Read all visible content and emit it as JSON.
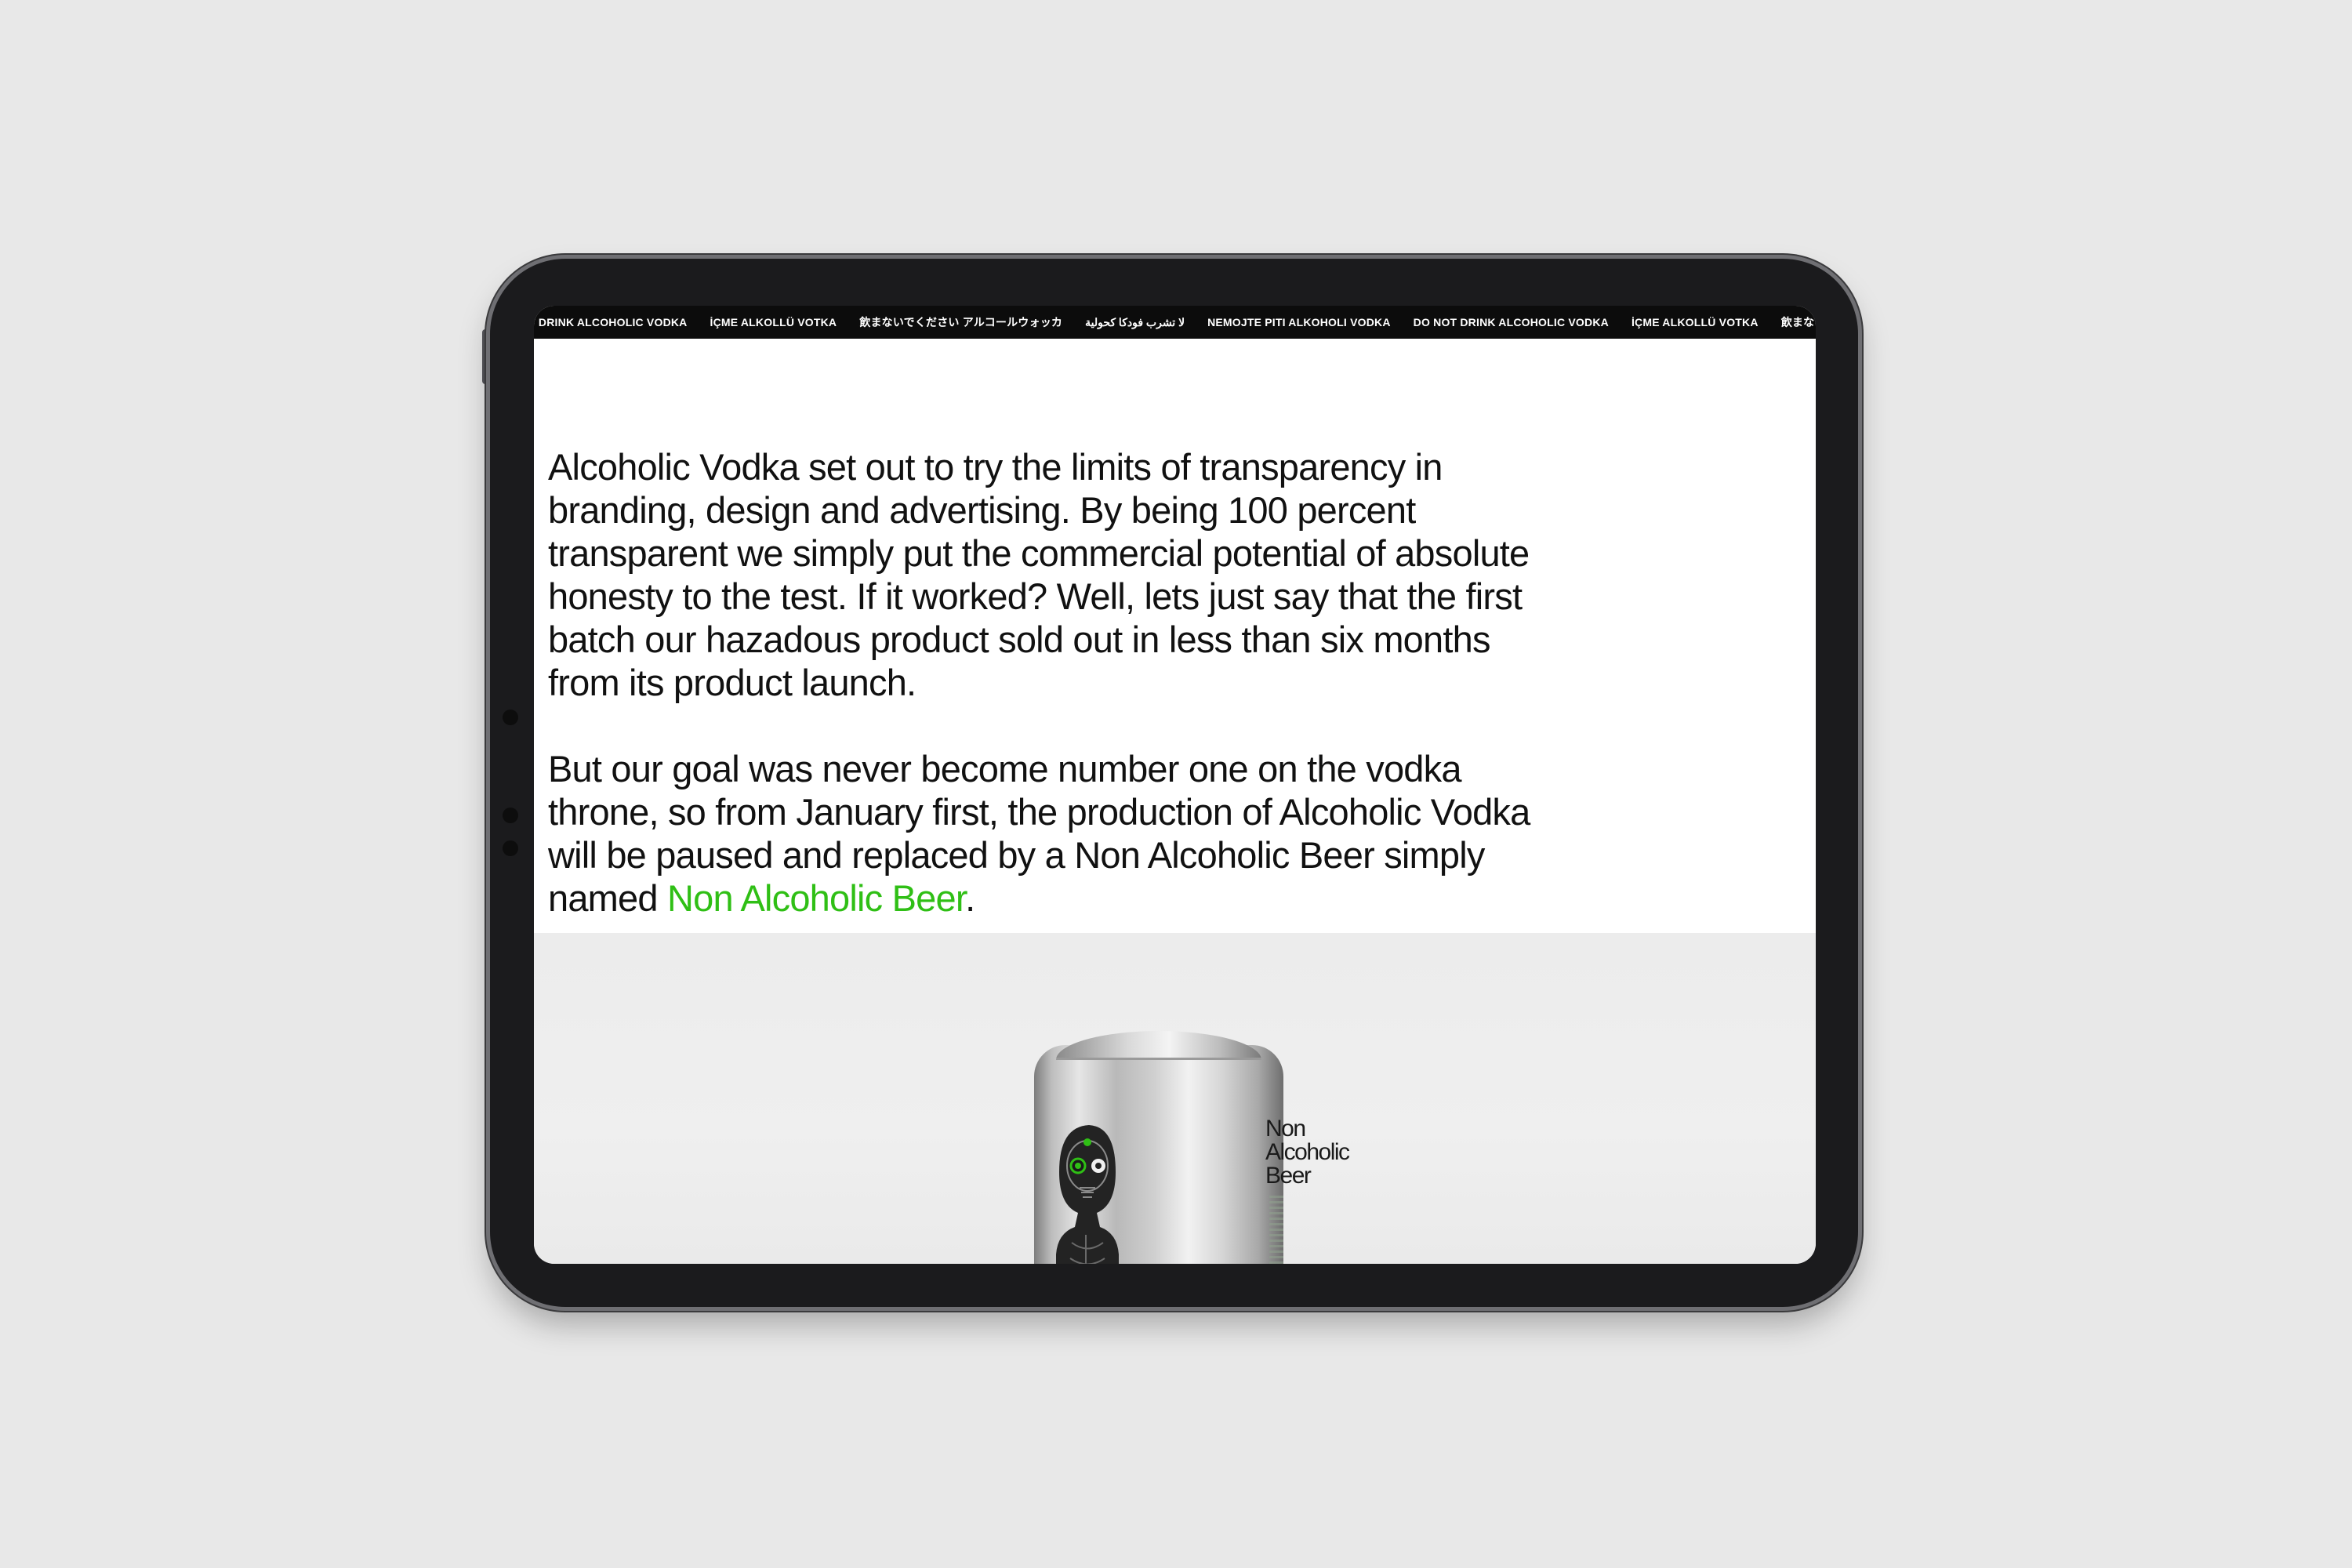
{
  "ticker": {
    "items": [
      "OT DRINK ALCOHOLIC VODKA",
      "İÇME ALKOLLÜ VOTKA",
      "飲まないでください アルコールウォッカ",
      "لا تشرب فودكا كحولية",
      "NEMOJTE PITI ALKOHOLI VODKA",
      "DO NOT DRINK ALCOHOLIC VODKA",
      "İÇME ALKOLLÜ VOTKA",
      "飲まないでください"
    ]
  },
  "intro": {
    "paragraph_1": "Alcoholic Vodka set out to try the limits of transparency in branding, design and advertising. By being 100 percent transparent we simply put the commercial potential of absolute honesty to the test. If it worked? Well, lets just say that the first batch our hazadous product sold out in less than six months from its product launch.",
    "paragraph_2_lead": "But our goal was never become number one on the vodka throne, so from January first, the production of Alcoholic Vodka will be paused and replaced by a Non Alcoholic Beer simply named ",
    "paragraph_2_link": "Non Alcoholic Beer",
    "paragraph_2_end": "."
  },
  "product": {
    "can_label_lines": [
      "Non",
      "Alcoholic",
      "Beer"
    ],
    "figure_icon": "skeleton-figure-icon"
  },
  "colors": {
    "highlight": "#2fbf15",
    "ticker_bg": "#0c0c0c",
    "text": "#111111"
  }
}
